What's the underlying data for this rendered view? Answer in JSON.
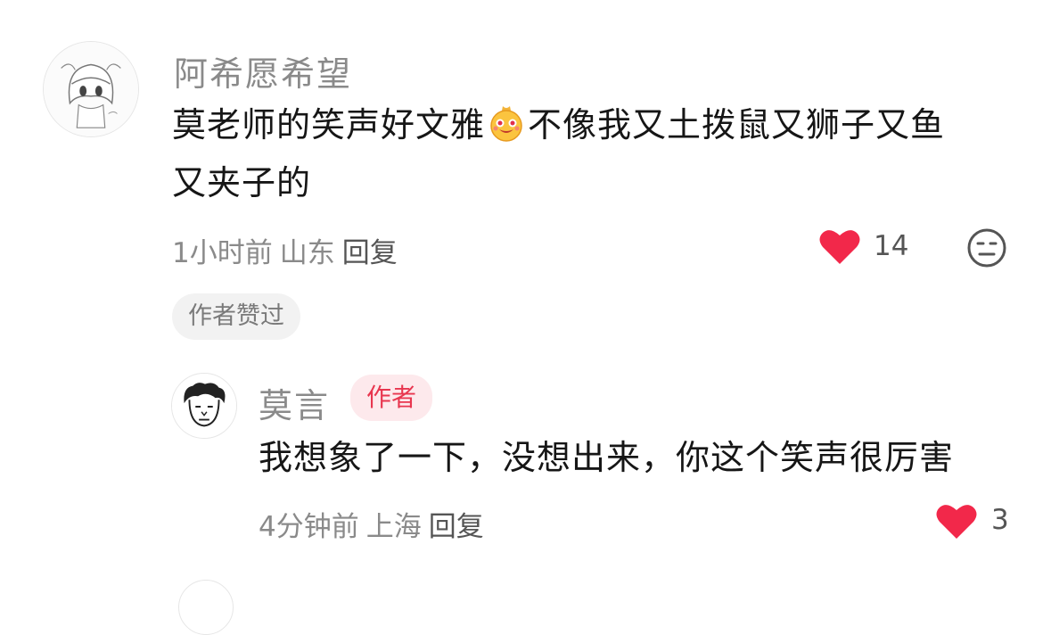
{
  "comment": {
    "username": "阿希愿希望",
    "text_part1": "莫老师的笑声好文雅",
    "emoji_icon": "grinning-bag-emoji",
    "text_part2": "不像我又土拨鼠又狮子又鱼",
    "text_line2": "又夹子的",
    "time": "1小时前",
    "location": "山东",
    "reply_label": "回复",
    "like_count": "14",
    "author_liked_badge": "作者赞过"
  },
  "reply": {
    "username": "莫言",
    "author_tag": "作者",
    "text": "我想象了一下，没想出来，你这个笑声很厉害",
    "time": "4分钟前",
    "location": "上海",
    "reply_label": "回复",
    "like_count": "3"
  },
  "colors": {
    "like_red": "#f2284a",
    "author_tag_bg": "#fde9ec",
    "author_tag_text": "#e8364f"
  }
}
